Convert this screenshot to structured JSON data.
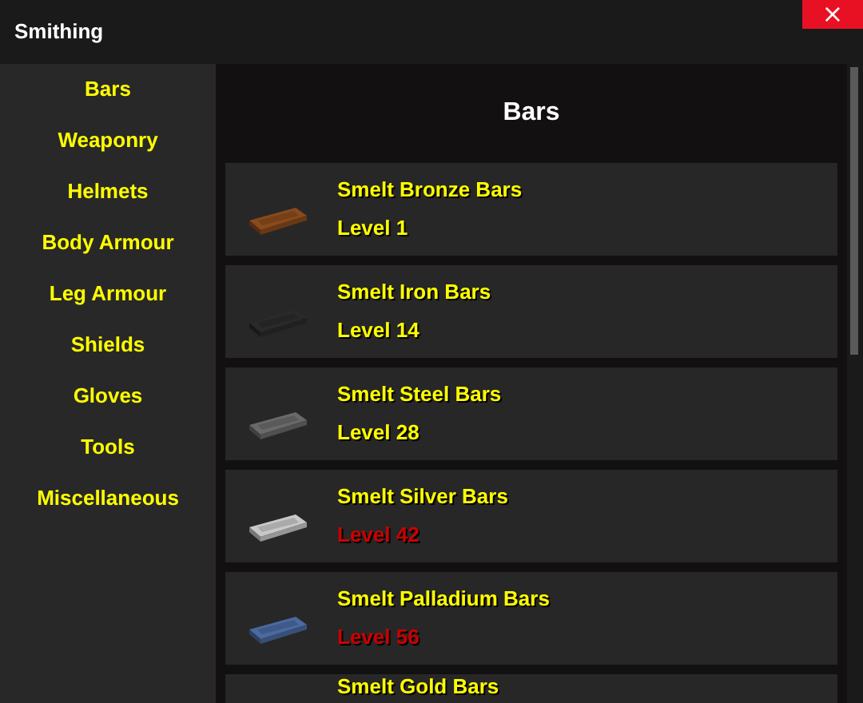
{
  "window": {
    "title": "Smithing",
    "close": "×"
  },
  "sidebar": {
    "items": [
      {
        "label": "Bars"
      },
      {
        "label": "Weaponry"
      },
      {
        "label": "Helmets"
      },
      {
        "label": "Body Armour"
      },
      {
        "label": "Leg Armour"
      },
      {
        "label": "Shields"
      },
      {
        "label": "Gloves"
      },
      {
        "label": "Tools"
      },
      {
        "label": "Miscellaneous"
      }
    ]
  },
  "content": {
    "heading": "Bars",
    "recipes": [
      {
        "name": "Smelt Bronze Bars",
        "level": "Level 1",
        "unlocked": true,
        "color": "#8a4a1c"
      },
      {
        "name": "Smelt Iron Bars",
        "level": "Level 14",
        "unlocked": true,
        "color": "#2a2a2a"
      },
      {
        "name": "Smelt Steel Bars",
        "level": "Level 28",
        "unlocked": true,
        "color": "#6a6a6a"
      },
      {
        "name": "Smelt Silver Bars",
        "level": "Level 42",
        "unlocked": false,
        "color": "#c8c8c8"
      },
      {
        "name": "Smelt Palladium Bars",
        "level": "Level 56",
        "unlocked": false,
        "color": "#4a6aa0"
      },
      {
        "name": "Smelt Gold Bars"
      }
    ]
  }
}
